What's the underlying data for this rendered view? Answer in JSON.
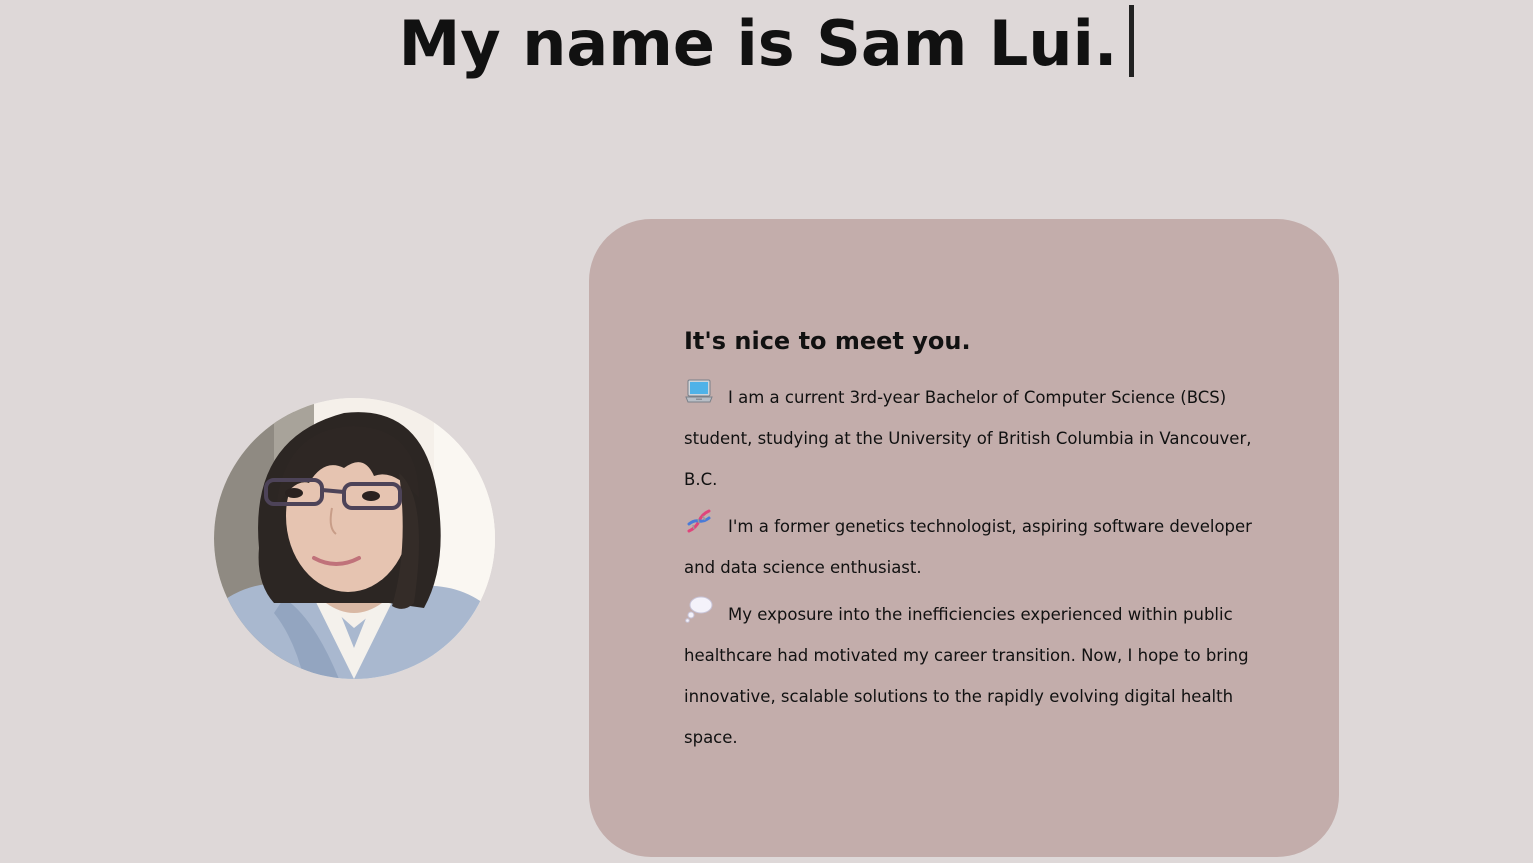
{
  "hero": {
    "title": "My name is Sam Lui."
  },
  "profile": {
    "photo_label": "profile photo"
  },
  "about": {
    "heading": "It's nice to meet you.",
    "paragraphs": [
      {
        "icon": "laptop-icon",
        "text": "I am a current 3rd-year Bachelor of Computer Science (BCS) student, studying at the University of British Columbia in Vancouver, B.C."
      },
      {
        "icon": "dna-icon",
        "text": "I'm a former genetics technologist, aspiring software developer and data science enthusiast."
      },
      {
        "icon": "thought-bubble-icon",
        "text": "My exposure into the inefficiencies experienced within public healthcare had motivated my career transition. Now, I hope to bring innovative, scalable solutions to the rapidly evolving digital health space."
      }
    ]
  },
  "colors": {
    "page_background": "#ded8d8",
    "card_background": "#c3adab",
    "text": "#111111"
  }
}
